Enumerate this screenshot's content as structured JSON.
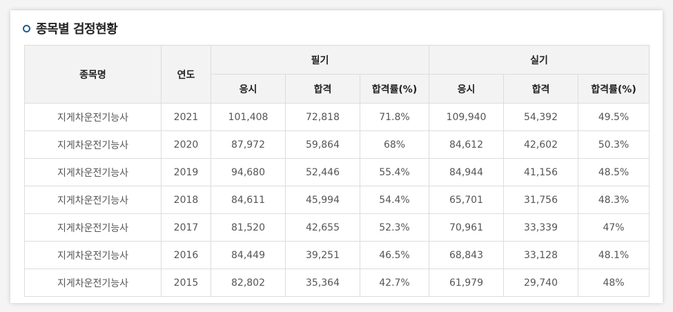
{
  "section": {
    "title": "종목별 검정현황"
  },
  "table": {
    "headers": {
      "name": "종목명",
      "year": "연도",
      "written": "필기",
      "practical": "실기",
      "sub": [
        "응시",
        "합격",
        "합격률(%)",
        "응시",
        "합격",
        "합격률(%)"
      ]
    },
    "rows": [
      [
        "지게차운전기능사",
        "2021",
        "101,408",
        "72,818",
        "71.8%",
        "109,940",
        "54,392",
        "49.5%"
      ],
      [
        "지게차운전기능사",
        "2020",
        "87,972",
        "59,864",
        "68%",
        "84,612",
        "42,602",
        "50.3%"
      ],
      [
        "지게차운전기능사",
        "2019",
        "94,680",
        "52,446",
        "55.4%",
        "84,944",
        "41,156",
        "48.5%"
      ],
      [
        "지게차운전기능사",
        "2018",
        "84,611",
        "45,994",
        "54.4%",
        "65,701",
        "31,756",
        "48.3%"
      ],
      [
        "지게차운전기능사",
        "2017",
        "81,520",
        "42,655",
        "52.3%",
        "70,961",
        "33,339",
        "47%"
      ],
      [
        "지게차운전기능사",
        "2016",
        "84,449",
        "39,251",
        "46.5%",
        "68,843",
        "33,128",
        "48.1%"
      ],
      [
        "지게차운전기능사",
        "2015",
        "82,802",
        "35,364",
        "42.7%",
        "61,979",
        "29,740",
        "48%"
      ]
    ]
  },
  "colors": {
    "header_bg": "#f3f3f3",
    "border": "#dcdcdc",
    "bullet": "#1f5c8c"
  }
}
